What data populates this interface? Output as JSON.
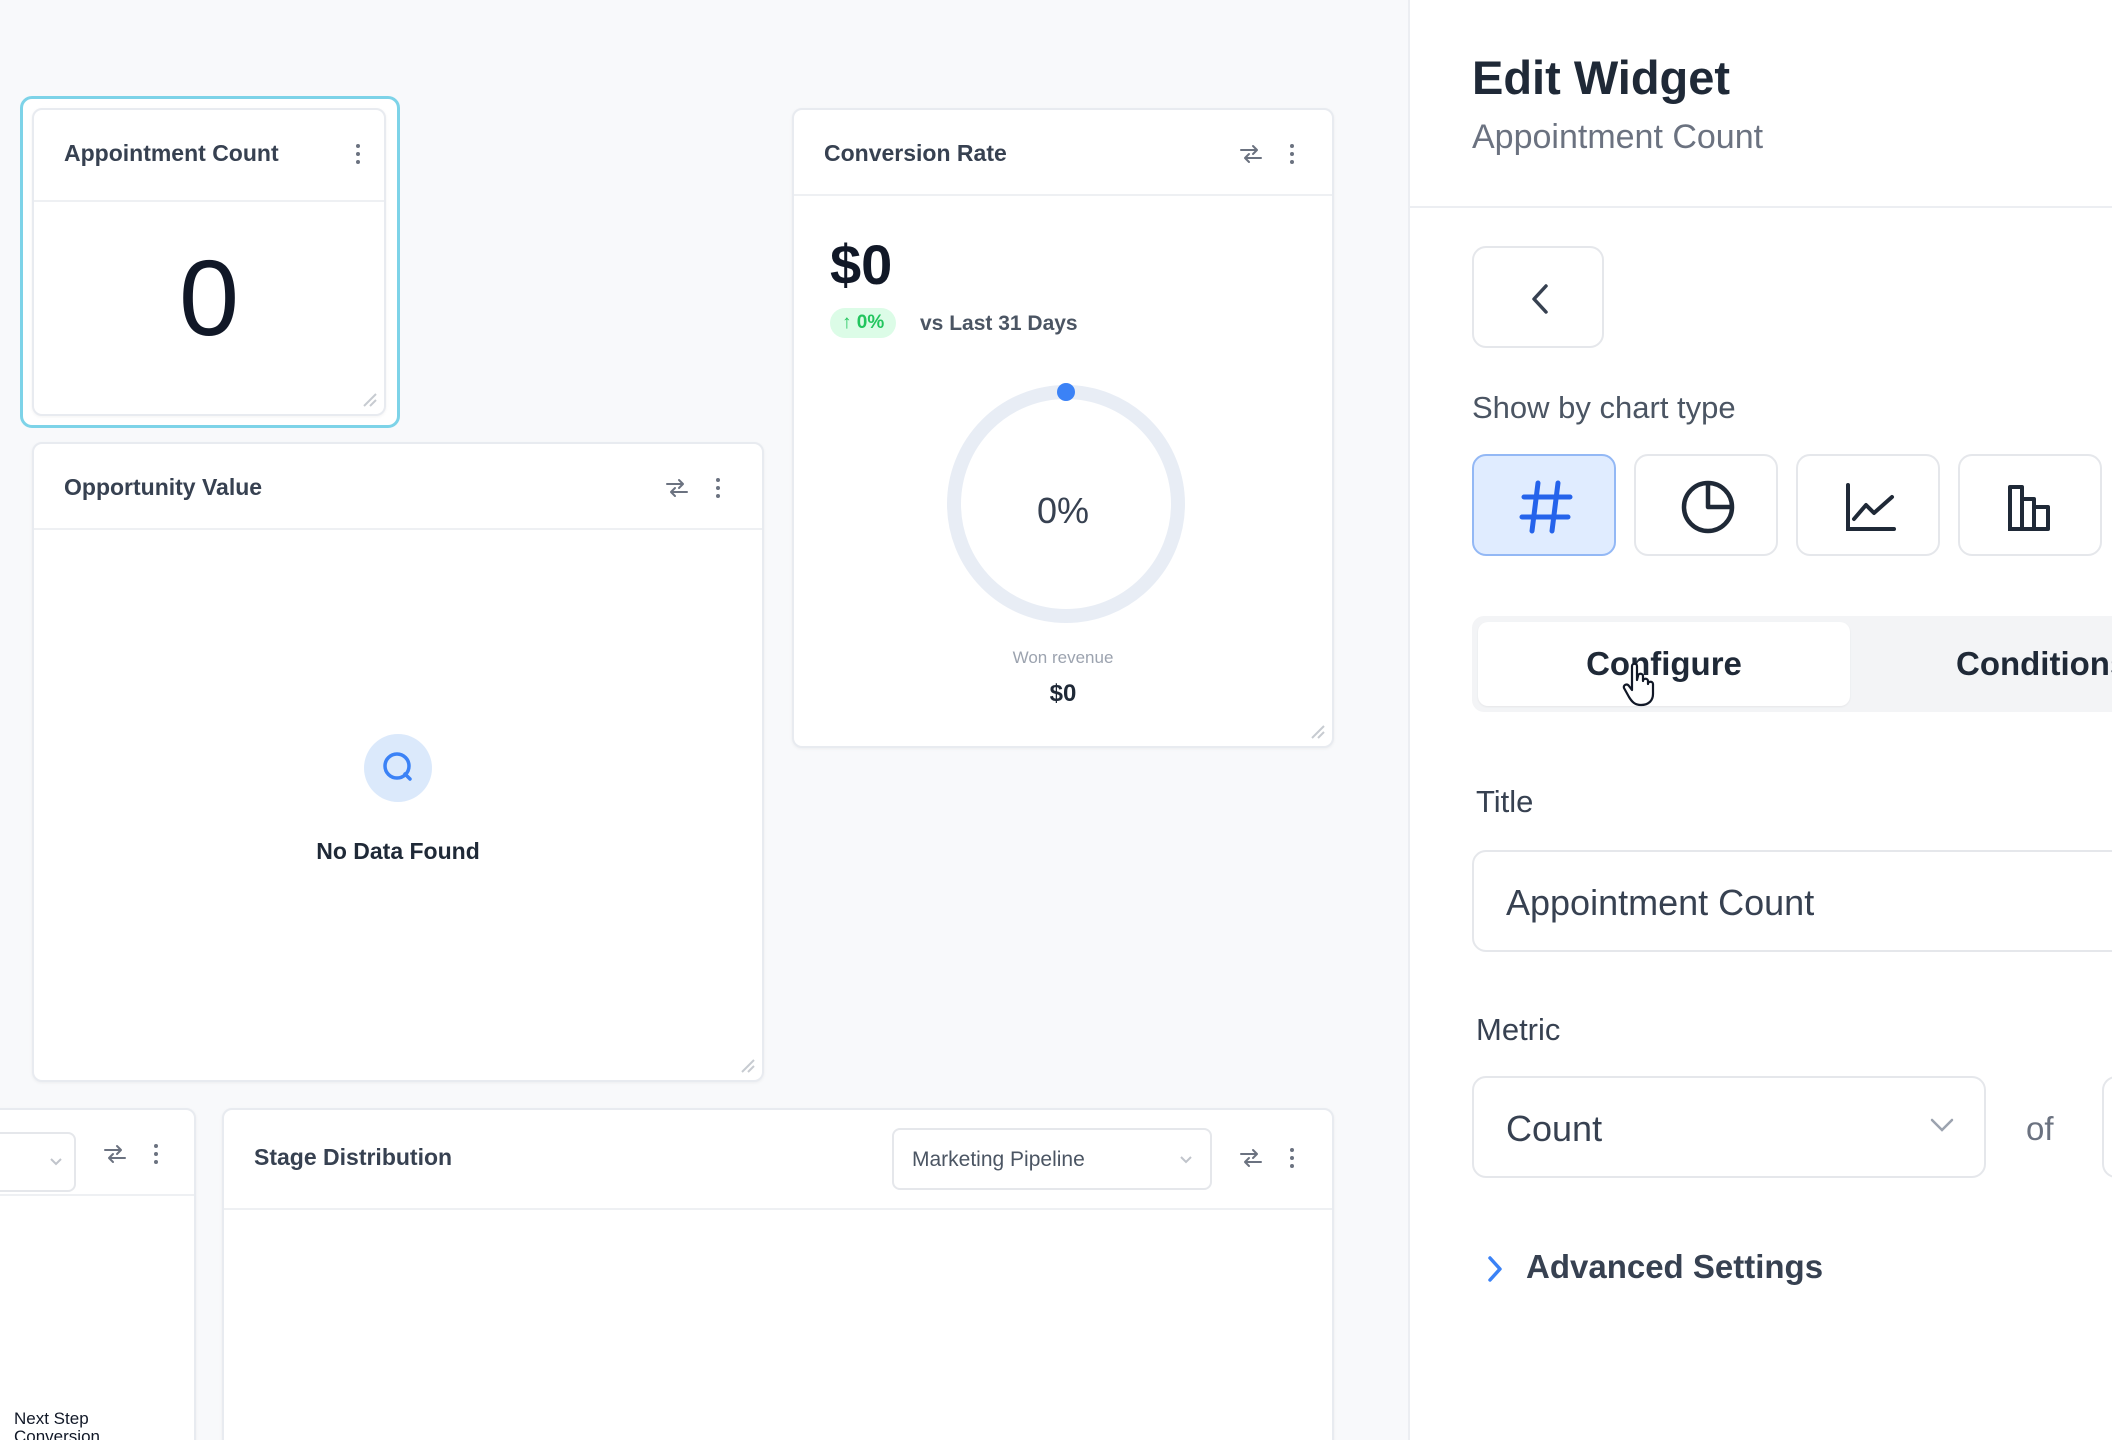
{
  "dashboard": {
    "appointment_count": {
      "title": "Appointment Count",
      "value": "0"
    },
    "opportunity_value": {
      "title": "Opportunity Value",
      "empty_text": "No Data Found"
    },
    "conversion_rate": {
      "title": "Conversion Rate",
      "amount": "$0",
      "change_badge": "↑ 0%",
      "comparison": "vs Last 31 Days",
      "gauge_percent": "0%",
      "gauge_fraction": 0,
      "won_label": "Won revenue",
      "won_value": "$0"
    },
    "next_step": {
      "label": "Next Step Conversion"
    },
    "stage_distribution": {
      "title": "Stage Distribution",
      "pipeline": "Marketing Pipeline"
    }
  },
  "panel": {
    "title": "Edit Widget",
    "subtitle": "Appointment Count",
    "chart_type_label": "Show by chart type",
    "chart_types": [
      "number",
      "pie",
      "line",
      "bar"
    ],
    "tabs": {
      "configure": "Configure",
      "conditions": "Conditions"
    },
    "title_label": "Title",
    "title_value": "Appointment Count",
    "metric_label": "Metric",
    "metric_value": "Count",
    "of_text": "of",
    "advanced": "Advanced Settings"
  },
  "colors": {
    "selection_ring": "#7dd3e8",
    "active_chart_type": "#e0ecff",
    "accent_blue": "#3b82f6",
    "badge_green": "#22c55e"
  }
}
